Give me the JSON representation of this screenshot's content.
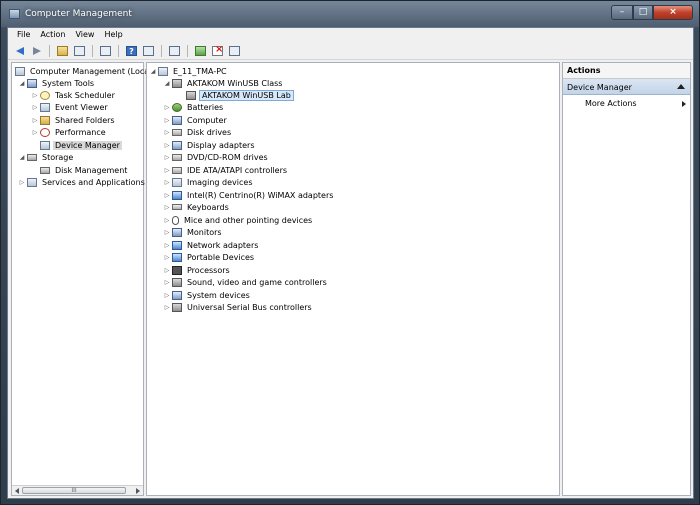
{
  "window": {
    "title": "Computer Management"
  },
  "menu": [
    "File",
    "Action",
    "View",
    "Help"
  ],
  "left_tree": {
    "root": "Computer Management (Local",
    "system_tools": "System Tools",
    "task_scheduler": "Task Scheduler",
    "event_viewer": "Event Viewer",
    "shared_folders": "Shared Folders",
    "performance": "Performance",
    "device_manager": "Device Manager",
    "storage": "Storage",
    "disk_management": "Disk Management",
    "services_apps": "Services and Applications",
    "scroll_grip": "III"
  },
  "device_tree": {
    "root": "E_11_TMA-PC",
    "aktakom_class": "AKTAKOM WinUSB Class",
    "aktakom_lab": "AKTAKOM WinUSB Lab",
    "categories": [
      "Batteries",
      "Computer",
      "Disk drives",
      "Display adapters",
      "DVD/CD-ROM drives",
      "IDE ATA/ATAPI controllers",
      "Imaging devices",
      "Intel(R) Centrino(R) WiMAX adapters",
      "Keyboards",
      "Mice and other pointing devices",
      "Monitors",
      "Network adapters",
      "Portable Devices",
      "Processors",
      "Sound, video and game controllers",
      "System devices",
      "Universal Serial Bus controllers"
    ]
  },
  "actions": {
    "header": "Actions",
    "section": "Device Manager",
    "more_actions": "More Actions"
  },
  "icons": {
    "aktakom": "usb-device-icon",
    "batteries": "battery-icon",
    "computer": "computer-icon",
    "disk": "disk-drive-icon",
    "network": "network-adapter-icon"
  },
  "colors": {
    "title_bar": "#4e5e70",
    "selection": "#d7e8fb",
    "actions_section": "#c3d4e8"
  }
}
